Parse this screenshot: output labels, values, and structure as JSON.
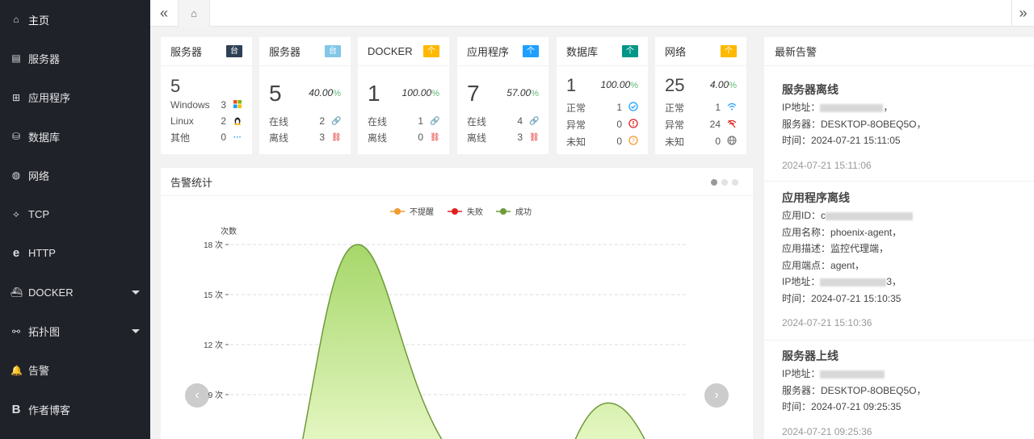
{
  "sidebar": {
    "items": [
      {
        "label": "主页",
        "icon": "⌂"
      },
      {
        "label": "服务器",
        "icon": "▤"
      },
      {
        "label": "应用程序",
        "icon": "⊞"
      },
      {
        "label": "数据库",
        "icon": "⛁"
      },
      {
        "label": "网络",
        "icon": "◍"
      },
      {
        "label": "TCP",
        "icon": "⟡"
      },
      {
        "label": "HTTP",
        "icon": "e"
      },
      {
        "label": "DOCKER",
        "icon": "⛴"
      },
      {
        "label": "拓扑图",
        "icon": "⚯"
      },
      {
        "label": "告警",
        "icon": "🔔"
      },
      {
        "label": "作者博客",
        "icon": "B"
      }
    ]
  },
  "topbar": {
    "prev_icon": "«",
    "home_icon": "⌂",
    "next_icon": "»"
  },
  "cards": {
    "c1": {
      "title": "服务器",
      "badge": "台",
      "total": "5",
      "rows": [
        {
          "label": "Windows",
          "value": "3"
        },
        {
          "label": "Linux",
          "value": "2"
        },
        {
          "label": "其他",
          "value": "0"
        }
      ]
    },
    "c2": {
      "title": "服务器",
      "badge": "台",
      "total": "5",
      "pct": "40.00",
      "pct_unit": "%",
      "rows": [
        {
          "label": "在线",
          "value": "2"
        },
        {
          "label": "离线",
          "value": "3"
        }
      ]
    },
    "c3": {
      "title": "DOCKER",
      "badge": "个",
      "total": "1",
      "pct": "100.00",
      "pct_unit": "%",
      "rows": [
        {
          "label": "在线",
          "value": "1"
        },
        {
          "label": "离线",
          "value": "0"
        }
      ]
    },
    "c4": {
      "title": "应用程序",
      "badge": "个",
      "total": "7",
      "pct": "57.00",
      "pct_unit": "%",
      "rows": [
        {
          "label": "在线",
          "value": "4"
        },
        {
          "label": "离线",
          "value": "3"
        }
      ]
    },
    "c5": {
      "title": "数据库",
      "badge": "个",
      "total": "1",
      "pct": "100.00",
      "pct_unit": "%",
      "rows": [
        {
          "label": "正常",
          "value": "1"
        },
        {
          "label": "异常",
          "value": "0"
        },
        {
          "label": "未知",
          "value": "0"
        }
      ]
    },
    "c6": {
      "title": "网络",
      "badge": "个",
      "total": "25",
      "pct": "4.00",
      "pct_unit": "%",
      "rows": [
        {
          "label": "正常",
          "value": "1"
        },
        {
          "label": "异常",
          "value": "24"
        },
        {
          "label": "未知",
          "value": "0"
        }
      ]
    }
  },
  "chart_panel": {
    "title": "告警统计"
  },
  "chart_data": {
    "type": "area",
    "ylabel": "次数",
    "yticks": [
      "18 次",
      "15 次",
      "12 次",
      "9 次"
    ],
    "ytick_values": [
      18,
      15,
      12,
      9
    ],
    "legend": [
      "不提醒",
      "失败",
      "成功"
    ],
    "colors": {
      "不提醒": "#f39a2e",
      "失败": "#e02020",
      "成功": "#6e9a3a"
    },
    "series": [
      {
        "name": "成功",
        "peaks": [
          {
            "x_frac": 0.28,
            "y": 18
          },
          {
            "x_frac": 0.83,
            "y": 8.5
          }
        ]
      }
    ]
  },
  "alerts": {
    "title": "最新告警",
    "items": [
      {
        "title": "服务器离线",
        "lines": [
          {
            "label": "IP地址：",
            "value": "",
            "masked": true,
            "suffix": "，"
          },
          {
            "label": "服务器：",
            "value": "DESKTOP-8OBEQ5O，"
          },
          {
            "label": "时间：",
            "value": "2024-07-21 15:11:05"
          }
        ],
        "ts": "2024-07-21 15:11:06"
      },
      {
        "title": "应用程序离线",
        "lines": [
          {
            "label": "应用ID：",
            "value": "c",
            "masked": true,
            "suffix": ""
          },
          {
            "label": "应用名称：",
            "value": "phoenix-agent，"
          },
          {
            "label": "应用描述：",
            "value": "监控代理端，"
          },
          {
            "label": "应用端点：",
            "value": "agent，"
          },
          {
            "label": "IP地址：",
            "value": "",
            "masked": true,
            "suffix": "3，"
          },
          {
            "label": "时间：",
            "value": "2024-07-21 15:10:35"
          }
        ],
        "ts": "2024-07-21 15:10:36"
      },
      {
        "title": "服务器上线",
        "lines": [
          {
            "label": "IP地址：",
            "value": "",
            "masked": true,
            "suffix": ""
          },
          {
            "label": "服务器：",
            "value": "DESKTOP-8OBEQ5O，"
          },
          {
            "label": "时间：",
            "value": "2024-07-21 09:25:35"
          }
        ],
        "ts": "2024-07-21 09:25:36"
      }
    ]
  }
}
